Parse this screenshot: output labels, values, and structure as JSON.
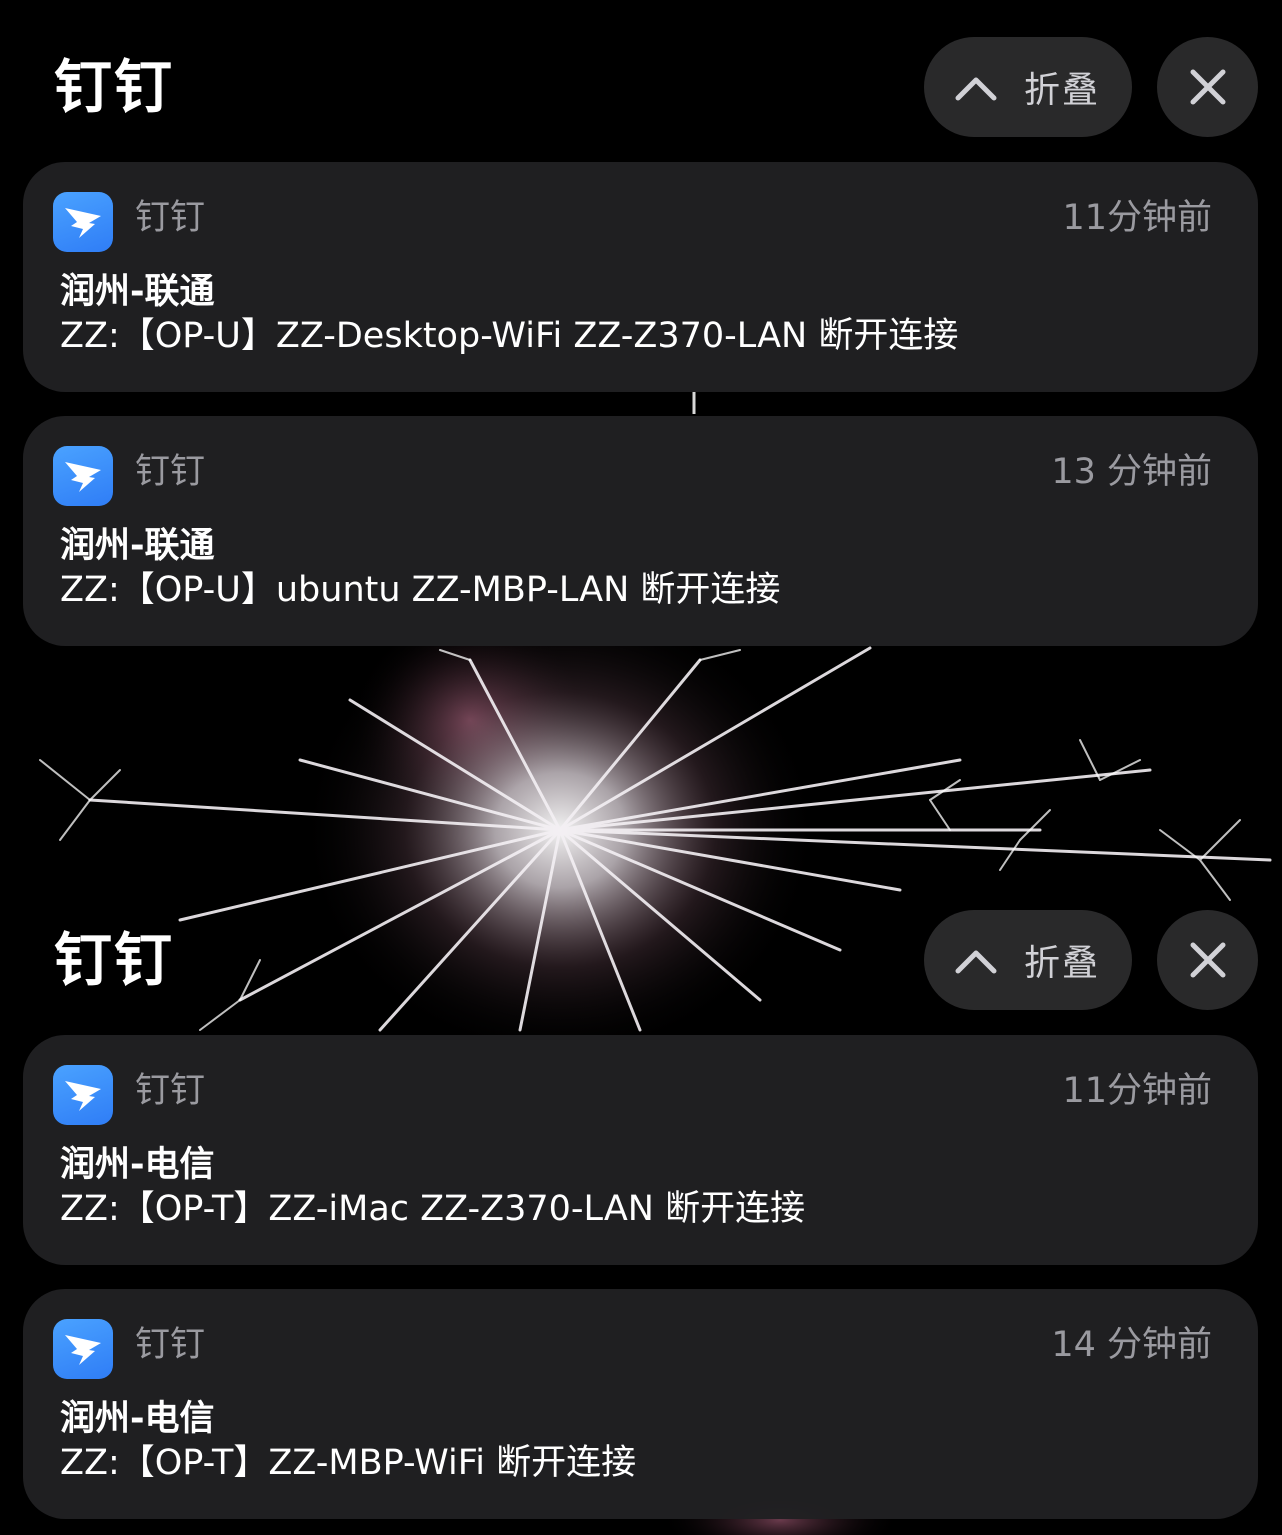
{
  "groups": [
    {
      "title": "钉钉",
      "collapse_label": "折叠",
      "notifications": [
        {
          "app_name": "钉钉",
          "time": "11分钟前",
          "title": "润州-联通",
          "body": "ZZ:【OP-U】ZZ-Desktop-WiFi ZZ-Z370-LAN 断开连接"
        },
        {
          "app_name": "钉钉",
          "time": "13 分钟前",
          "title": "润州-联通",
          "body": "ZZ:【OP-U】ubuntu ZZ-MBP-LAN 断开连接"
        }
      ]
    },
    {
      "title": "钉钉",
      "collapse_label": "折叠",
      "notifications": [
        {
          "app_name": "钉钉",
          "time": "11分钟前",
          "title": "润州-电信",
          "body": "ZZ:【OP-T】ZZ-iMac ZZ-Z370-LAN 断开连接"
        },
        {
          "app_name": "钉钉",
          "time": "14 分钟前",
          "title": "润州-电信",
          "body": "ZZ:【OP-T】ZZ-MBP-WiFi 断开连接"
        }
      ]
    }
  ],
  "icons": {
    "app": "dingtalk-icon",
    "collapse": "chevron-up-icon",
    "close": "close-icon"
  },
  "colors": {
    "background": "#000000",
    "card": "#202022",
    "button": "#2c2c2e",
    "secondary_text": "#9a9aa0",
    "app_icon": "#3a8ff9"
  }
}
